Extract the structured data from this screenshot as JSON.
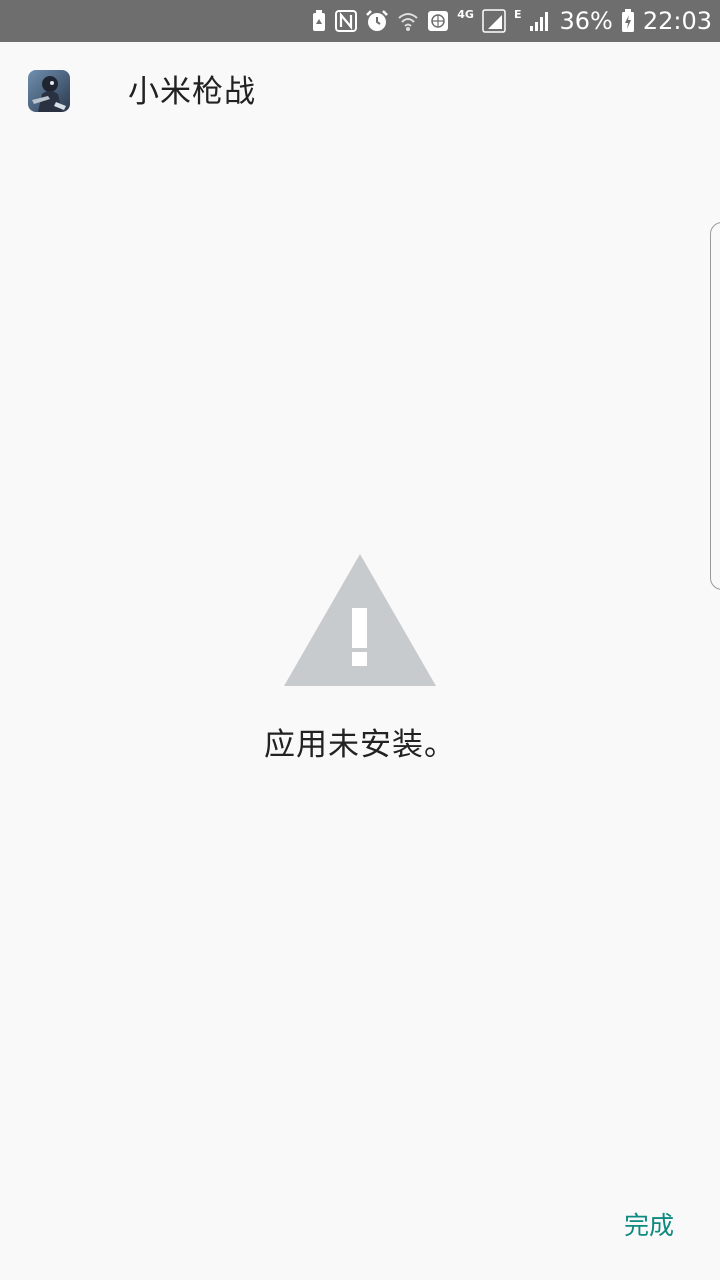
{
  "status_bar": {
    "network_label": "4G",
    "network2_label": "E",
    "battery_percent": "36%",
    "time": "22:03",
    "icons": [
      "recycle-battery-icon",
      "nfc-icon",
      "alarm-icon",
      "wifi-icon",
      "vpn-globe-icon",
      "signal-4g-icon",
      "signal-e-icon",
      "battery-charging-icon"
    ]
  },
  "app": {
    "name": "小米枪战",
    "icon": "app-game-icon"
  },
  "main": {
    "icon": "warning-triangle-icon",
    "message": "应用未安装。"
  },
  "footer": {
    "done_label": "完成"
  },
  "colors": {
    "status_bar_bg": "#6e6e6e",
    "background": "#f9f9f9",
    "warning_icon": "#c8cbce",
    "accent": "#0e8a80",
    "text": "#222222"
  }
}
